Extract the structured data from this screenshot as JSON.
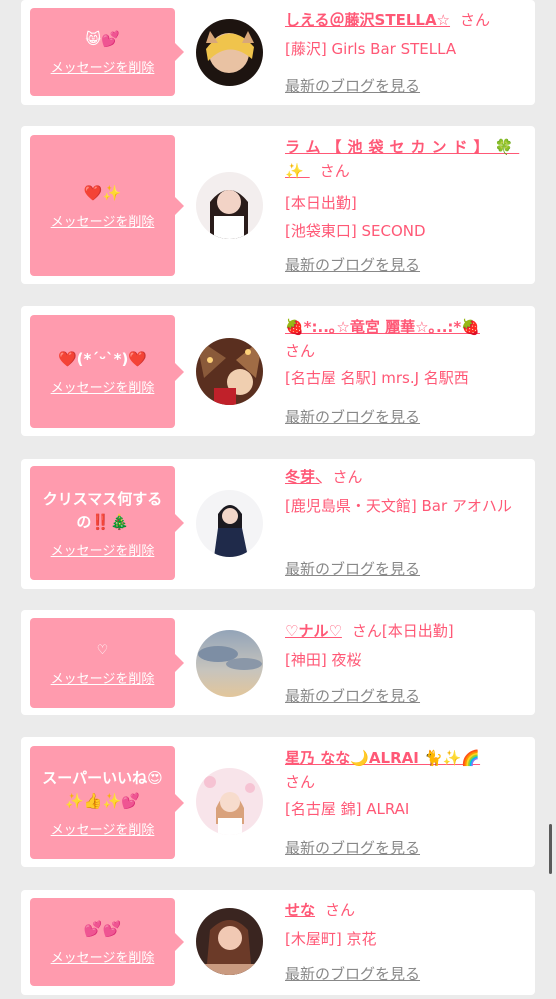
{
  "common": {
    "delete_label": "メッセージを削除",
    "blog_label": "最新のブログを見る",
    "honorific": "さん"
  },
  "cards": [
    {
      "message": "😸💕",
      "name": "しえる＠藤沢STELLA☆",
      "shop": "[藤沢] Girls Bar STELLA",
      "extra": ""
    },
    {
      "message": "❤️✨",
      "name": "ラム【池袋セカンド】🍀✨",
      "shop": "[本日出勤]",
      "shop2": "[池袋東口] SECOND",
      "extra": ""
    },
    {
      "message": "❤️(*´ᵕ`*)❤️",
      "name": "🍓*:..｡☆竜宮 麗華☆｡..:*🍓",
      "shop": "[名古屋 名駅] mrs.J 名駅西",
      "extra": ""
    },
    {
      "message": "クリスマス何するの‼️🎄",
      "name": "冬芽⸜",
      "shop": "[鹿児島県・天文館] Bar アオハル",
      "extra": ""
    },
    {
      "message": "♡",
      "name": "♡ナル♡",
      "shop": "[神田] 夜桜",
      "extra": "[本日出勤]"
    },
    {
      "message": "スーパーいいね😍✨👍✨💕",
      "name": "星乃 なな🌙ALRAI 🐈✨🌈",
      "shop": "[名古屋 錦] ALRAI",
      "extra": ""
    },
    {
      "message": "💕💕",
      "name": "せな",
      "shop": "[木屋町] 京花",
      "extra": ""
    }
  ],
  "colors": {
    "page_bg": "#ebebeb",
    "bubble": "#ff9bae",
    "name_text": "#ff5876",
    "link_gray": "#888888"
  }
}
